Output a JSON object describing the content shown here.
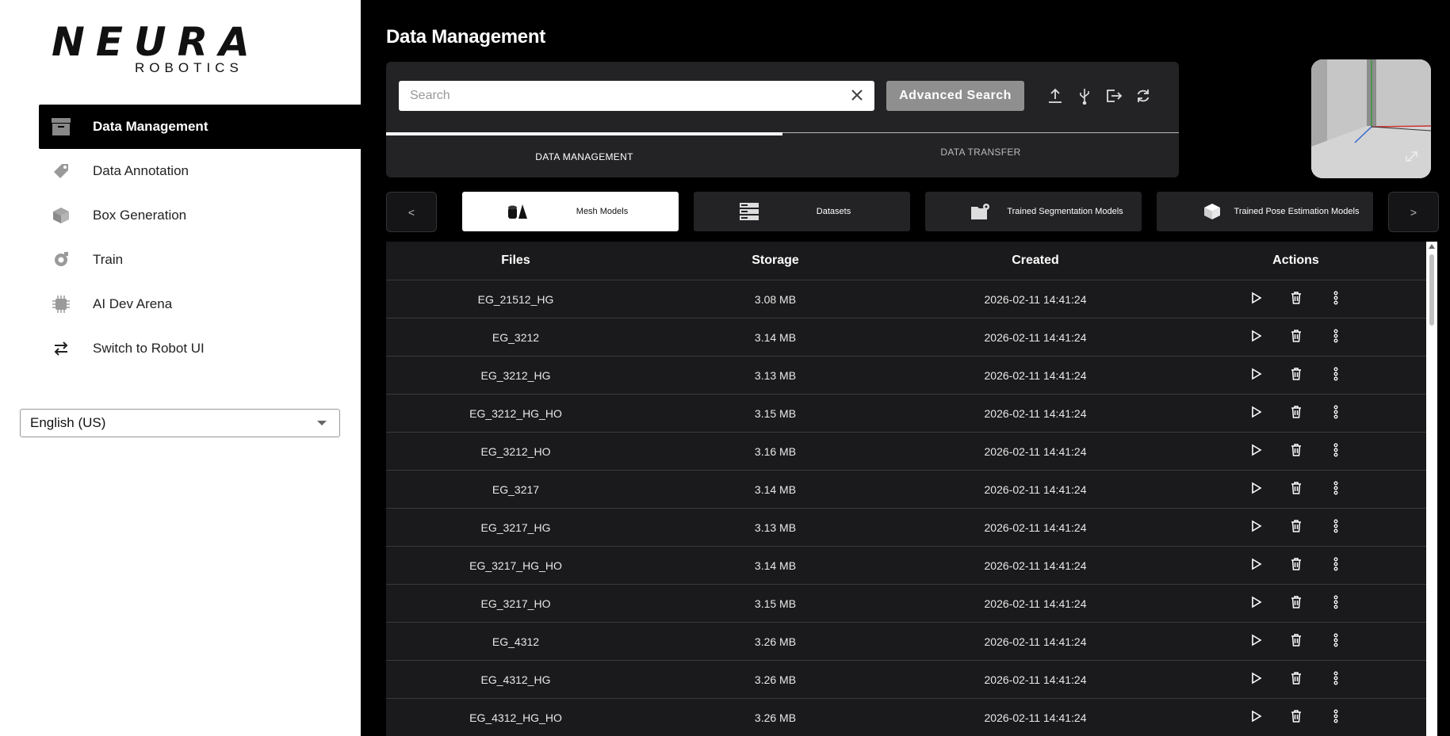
{
  "brand": {
    "name": "NEURA",
    "sub": "ROBOTICS"
  },
  "sidebar": {
    "items": [
      {
        "label": "Data Management",
        "icon": "archive-icon",
        "active": true
      },
      {
        "label": "Data Annotation",
        "icon": "tag-icon",
        "active": false
      },
      {
        "label": "Box Generation",
        "icon": "cube-icon",
        "active": false
      },
      {
        "label": "Train",
        "icon": "gear-icon",
        "active": false
      },
      {
        "label": "AI Dev Arena",
        "icon": "chip-icon",
        "active": false
      },
      {
        "label": "Switch to Robot UI",
        "icon": "swap-arrows-icon",
        "active": false
      }
    ],
    "language": "English (US)"
  },
  "header": {
    "title": "Data Management"
  },
  "search": {
    "placeholder": "Search",
    "value": "",
    "advanced_label": "Advanced Search"
  },
  "toolbar_icons": [
    "upload-icon",
    "usb-icon",
    "export-icon",
    "refresh-icon"
  ],
  "tabs": [
    {
      "label": "DATA MANAGEMENT",
      "active": true
    },
    {
      "label": "DATA TRANSFER",
      "active": false
    }
  ],
  "categories": {
    "prev": "<",
    "next": ">",
    "items": [
      {
        "label": "Mesh Models",
        "icon": "mesh-models-icon",
        "active": true
      },
      {
        "label": "Datasets",
        "icon": "datasets-icon",
        "active": false
      },
      {
        "label": "Trained Segmentation Models",
        "icon": "segmentation-model-icon",
        "active": false
      },
      {
        "label": "Trained Pose Estimation Models",
        "icon": "pose-model-icon",
        "active": false
      }
    ]
  },
  "table": {
    "columns": [
      "Files",
      "Storage",
      "Created",
      "Actions"
    ],
    "rows": [
      {
        "file": "EG_21512_HG",
        "storage": "3.08 MB",
        "created": "2026-02-11 14:41:24"
      },
      {
        "file": "EG_3212",
        "storage": "3.14 MB",
        "created": "2026-02-11 14:41:24"
      },
      {
        "file": "EG_3212_HG",
        "storage": "3.13 MB",
        "created": "2026-02-11 14:41:24"
      },
      {
        "file": "EG_3212_HG_HO",
        "storage": "3.15 MB",
        "created": "2026-02-11 14:41:24"
      },
      {
        "file": "EG_3212_HO",
        "storage": "3.16 MB",
        "created": "2026-02-11 14:41:24"
      },
      {
        "file": "EG_3217",
        "storage": "3.14 MB",
        "created": "2026-02-11 14:41:24"
      },
      {
        "file": "EG_3217_HG",
        "storage": "3.13 MB",
        "created": "2026-02-11 14:41:24"
      },
      {
        "file": "EG_3217_HG_HO",
        "storage": "3.14 MB",
        "created": "2026-02-11 14:41:24"
      },
      {
        "file": "EG_3217_HO",
        "storage": "3.15 MB",
        "created": "2026-02-11 14:41:24"
      },
      {
        "file": "EG_4312",
        "storage": "3.26 MB",
        "created": "2026-02-11 14:41:24"
      },
      {
        "file": "EG_4312_HG",
        "storage": "3.26 MB",
        "created": "2026-02-11 14:41:24"
      },
      {
        "file": "EG_4312_HG_HO",
        "storage": "3.26 MB",
        "created": "2026-02-11 14:41:24"
      }
    ],
    "row_actions": [
      "play-icon",
      "trash-icon",
      "more-vertical-icon"
    ]
  },
  "colors": {
    "background": "#000000",
    "sidebar": "#ffffff",
    "panel": "#232326",
    "table": "#1a1a1c",
    "button_disabled": "#8f8f8f"
  }
}
